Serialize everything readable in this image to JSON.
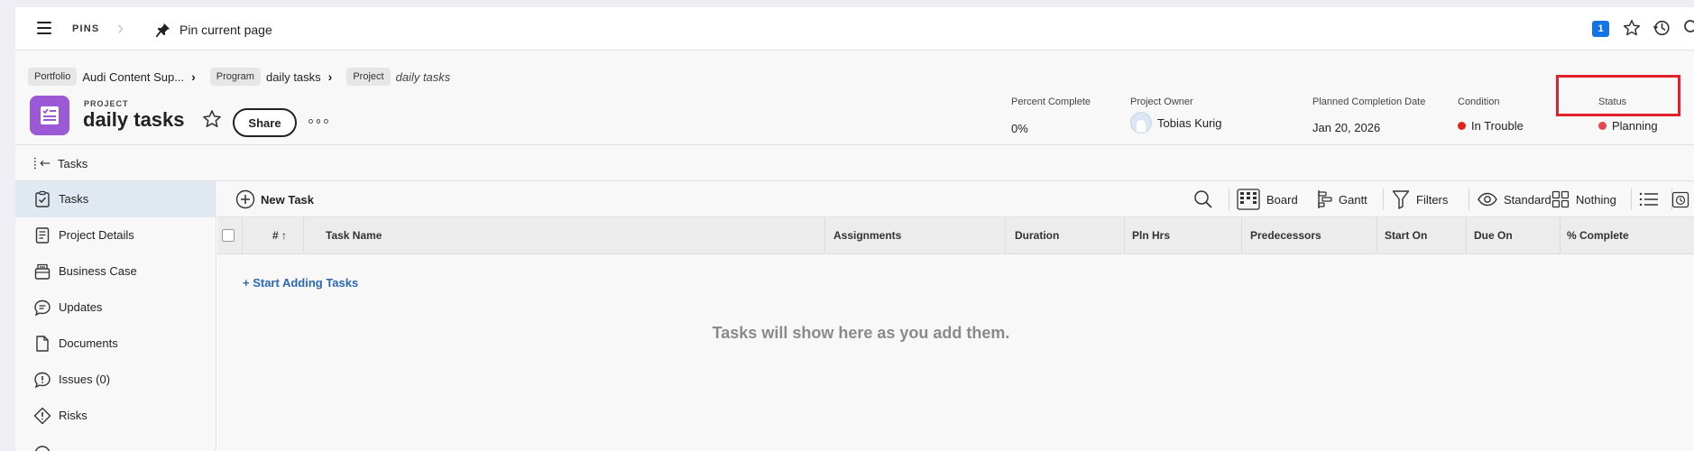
{
  "topbar": {
    "pins_label": "PINS",
    "pin_current_label": "Pin current page",
    "notification_count": "1"
  },
  "breadcrumb": {
    "items": [
      {
        "type": "Portfolio",
        "name": "Audi Content Sup..."
      },
      {
        "type": "Program",
        "name": "daily tasks"
      },
      {
        "type": "Project",
        "name": "daily tasks"
      }
    ]
  },
  "project": {
    "type_label": "PROJECT",
    "name": "daily tasks",
    "share_label": "Share"
  },
  "meta": {
    "percent_complete": {
      "label": "Percent Complete",
      "value": "0%"
    },
    "owner": {
      "label": "Project Owner",
      "value": "Tobias Kurig"
    },
    "planned_completion": {
      "label": "Planned Completion Date",
      "value": "Jan 20, 2026"
    },
    "condition": {
      "label": "Condition",
      "value": "In Trouble",
      "color": "#e1251b"
    },
    "status": {
      "label": "Status",
      "value": "Planning",
      "color": "#e34850"
    }
  },
  "back": {
    "label": "Tasks"
  },
  "sidebar": {
    "items": [
      {
        "label": "Tasks",
        "icon": "tasks-icon",
        "active": true
      },
      {
        "label": "Project Details",
        "icon": "details-icon"
      },
      {
        "label": "Business Case",
        "icon": "business-case-icon"
      },
      {
        "label": "Updates",
        "icon": "updates-icon"
      },
      {
        "label": "Documents",
        "icon": "document-icon"
      },
      {
        "label": "Issues (0)",
        "icon": "issues-icon"
      },
      {
        "label": "Risks",
        "icon": "risks-icon"
      }
    ]
  },
  "toolbar": {
    "new_task_label": "New Task",
    "board_label": "Board",
    "gantt_label": "Gantt",
    "filters_label": "Filters",
    "view_label": "Standard",
    "grouping_label": "Nothing"
  },
  "table": {
    "columns": [
      "# ↑",
      "Task Name",
      "Assignments",
      "Duration",
      "Pln Hrs",
      "Predecessors",
      "Start On",
      "Due On",
      "% Complete"
    ],
    "start_adding_label": "+ Start Adding Tasks",
    "empty_message": "Tasks will show here as you add them."
  },
  "colors": {
    "project_icon": "#9b59d6",
    "accent_blue": "#1473e6",
    "highlight_red": "#e4202a"
  }
}
